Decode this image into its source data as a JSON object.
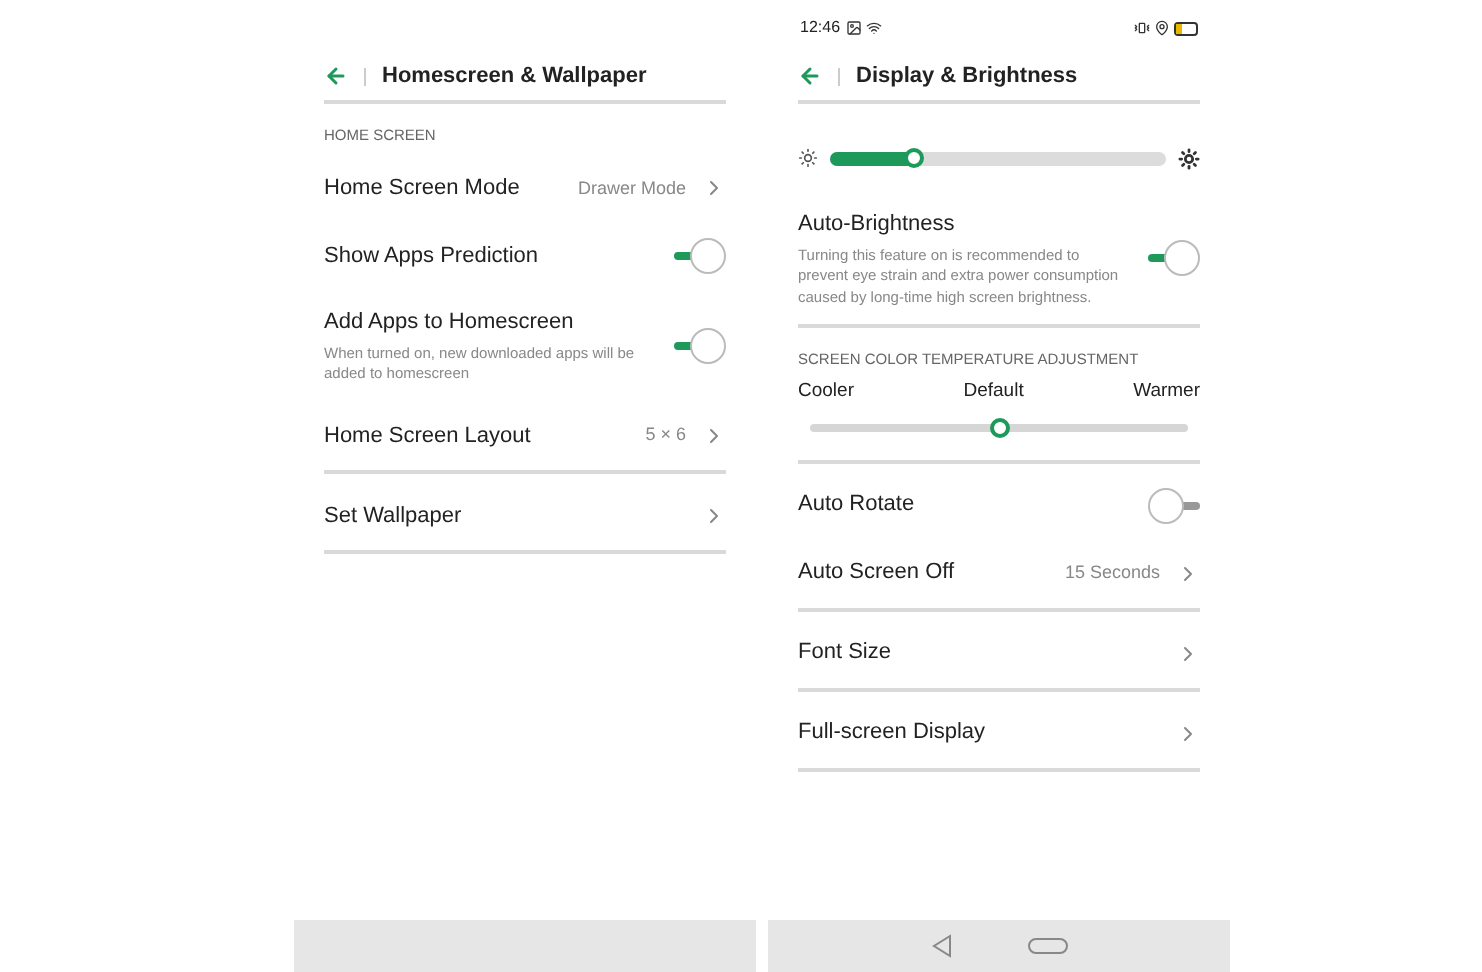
{
  "screens": [
    {
      "header": {
        "title": "Homescreen & Wallpaper"
      },
      "groups": [
        {
          "label": "HOME SCREEN",
          "rows": [
            {
              "kind": "link",
              "label": "Home Screen Mode",
              "value": "Drawer Mode"
            },
            {
              "kind": "toggle",
              "label": "Show Apps Prediction",
              "on": true
            },
            {
              "kind": "toggle",
              "label": "Add Apps to Homescreen",
              "description": "When turned on, new downloaded apps will be added to homescreen",
              "on": true
            },
            {
              "kind": "link",
              "label": "Home Screen Layout",
              "value": "5 × 6"
            }
          ]
        },
        {
          "rows": [
            {
              "kind": "link",
              "label": "Set Wallpaper"
            }
          ]
        }
      ],
      "nav_buttons": false
    },
    {
      "status_bar": {
        "time": "12:46"
      },
      "header": {
        "title": "Display & Brightness"
      },
      "groups": [
        {
          "rows": [
            {
              "kind": "brightness",
              "level": 0.25
            },
            {
              "kind": "toggle",
              "label": "Auto-Brightness",
              "description": "Turning this feature on is recommended to prevent eye strain and extra power consumption caused by long-time high screen brightness.",
              "on": true
            }
          ]
        },
        {
          "label": "SCREEN COLOR TEMPERATURE ADJUSTMENT",
          "rows": [
            {
              "kind": "temperature",
              "marks": [
                "Cooler",
                "Default",
                "Warmer"
              ],
              "level": 0.5
            }
          ]
        },
        {
          "rows": [
            {
              "kind": "toggle",
              "label": "Auto Rotate",
              "on": false
            },
            {
              "kind": "link",
              "label": "Auto Screen Off",
              "value": "15 Seconds"
            }
          ]
        },
        {
          "rows": [
            {
              "kind": "link",
              "label": "Font Size"
            }
          ]
        },
        {
          "rows": [
            {
              "kind": "link",
              "label": "Full-screen Display"
            }
          ]
        }
      ],
      "nav_buttons": true
    }
  ]
}
